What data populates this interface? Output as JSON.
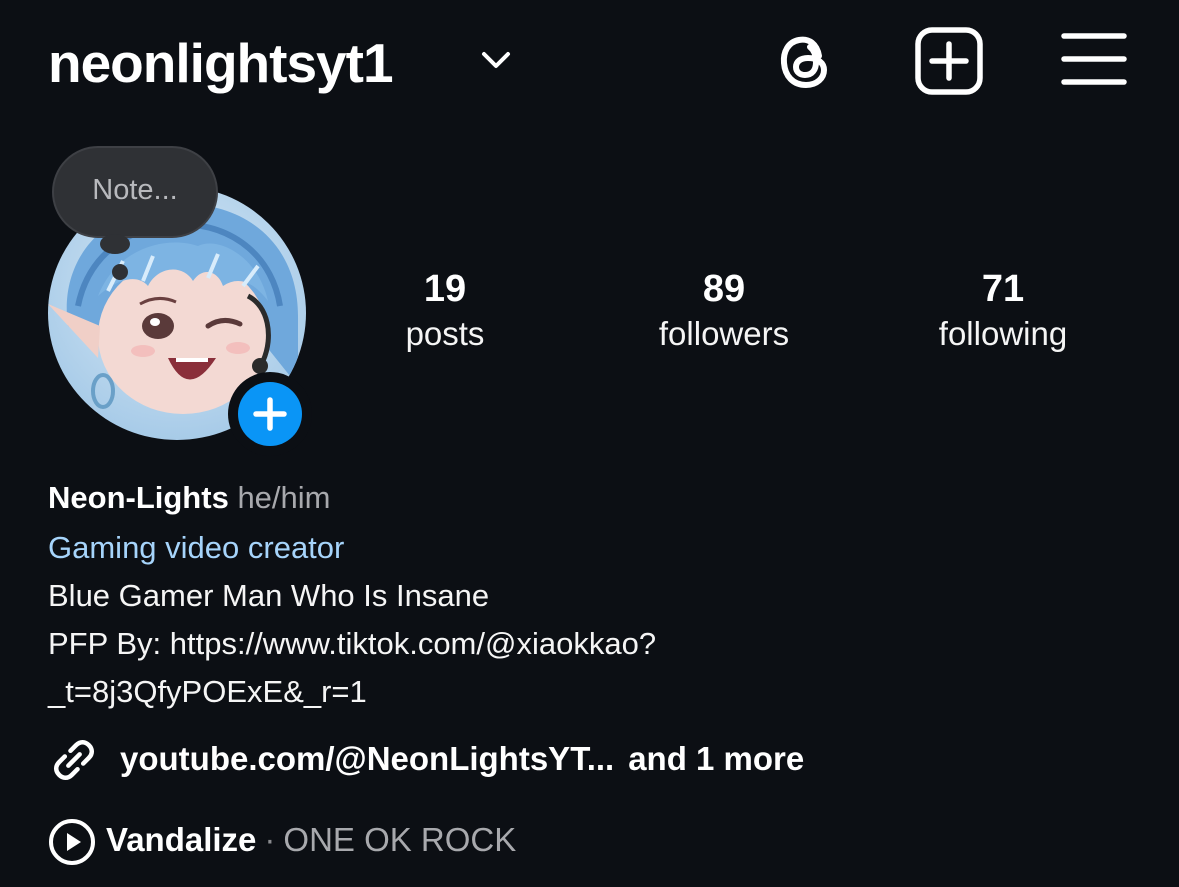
{
  "header": {
    "username": "neonlightsyt1",
    "icons": [
      "chevron-down-icon",
      "threads-icon",
      "new-post-icon",
      "menu-icon"
    ]
  },
  "profile": {
    "note_placeholder": "Note...",
    "avatar": "anime-elf-avatar",
    "stats": {
      "posts": {
        "value": "19",
        "label": "posts"
      },
      "followers": {
        "value": "89",
        "label": "followers"
      },
      "following": {
        "value": "71",
        "label": "following"
      }
    }
  },
  "bio": {
    "name": "Neon-Lights",
    "pronouns": "he/him",
    "category": "Gaming video creator",
    "lines": [
      "Blue Gamer Man Who Is Insane",
      "PFP By: https://www.tiktok.com/@xiaokkao?",
      "_t=8j3QfyPOExE&_r=1"
    ],
    "link": "youtube.com/@NeonLightsYT...",
    "link_more": "and 1 more"
  },
  "music": {
    "song": "Vandalize",
    "separator": "·",
    "artist": "ONE OK ROCK"
  },
  "colors": {
    "background": "#0c0f14",
    "accent_blue": "#0a95f6",
    "category_blue": "#a6d4fb",
    "secondary_text": "#a8a9ad"
  }
}
